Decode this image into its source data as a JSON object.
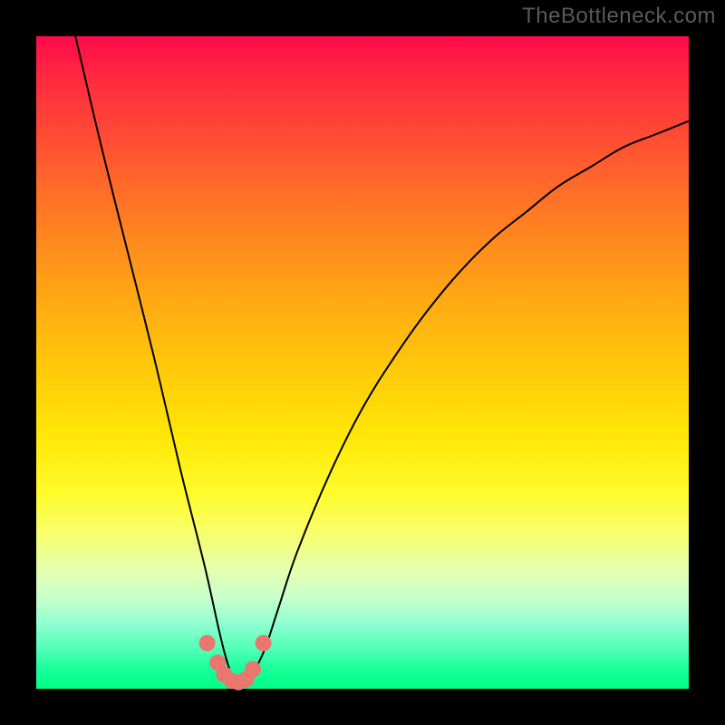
{
  "watermark": "TheBottleneck.com",
  "colors": {
    "background": "#000000",
    "curve": "#000000",
    "marker": "#e8776f",
    "gradient_top": "#ff0a4a",
    "gradient_bottom": "#00ff86"
  },
  "chart_data": {
    "type": "line",
    "title": "",
    "xlabel": "",
    "ylabel": "",
    "xlim": [
      0,
      100
    ],
    "ylim": [
      0,
      100
    ],
    "series": [
      {
        "name": "bottleneck-curve",
        "x": [
          6,
          10,
          14,
          18,
          22,
          24,
          26,
          28,
          29,
          30,
          31,
          32,
          33,
          35,
          37,
          40,
          45,
          50,
          55,
          60,
          65,
          70,
          75,
          80,
          85,
          90,
          95,
          100
        ],
        "y": [
          100,
          83,
          67,
          51,
          34,
          26,
          18,
          9,
          5,
          2,
          1,
          1,
          2,
          6,
          12,
          21,
          33,
          43,
          51,
          58,
          64,
          69,
          73,
          77,
          80,
          83,
          85,
          87
        ]
      }
    ],
    "markers": {
      "name": "highlight-points",
      "x": [
        26.2,
        27.8,
        28.8,
        30.0,
        31.0,
        32.2,
        33.2,
        34.8
      ],
      "y": [
        7.0,
        4.0,
        2.2,
        1.2,
        1.0,
        1.5,
        3.0,
        7.0
      ]
    },
    "annotations": []
  }
}
